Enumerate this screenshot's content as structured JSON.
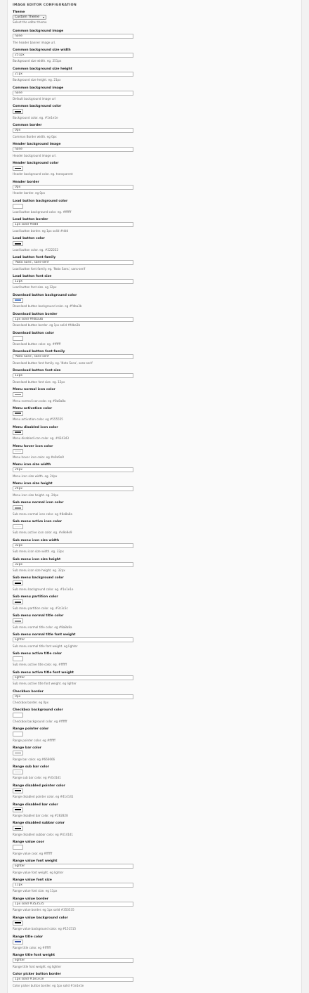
{
  "header": {
    "title": "IMAGE EDITOR CONFIGURATION"
  },
  "theme": {
    "label": "Theme",
    "selected": "Custom Theme",
    "arrow": "▾",
    "description": "Select the editor theme"
  },
  "fields": [
    {
      "label": "Common background image",
      "type": "text",
      "value": "none",
      "description": "The header banner image url."
    },
    {
      "label": "Common background size width",
      "type": "text",
      "value": "251px",
      "description": "Background size width. eg. 251px"
    },
    {
      "label": "Common background size height",
      "type": "text",
      "value": "21px",
      "description": "Background size height. eg. 21px"
    },
    {
      "label": "Common background image",
      "type": "text",
      "value": "none",
      "description": "Default background image url"
    },
    {
      "label": "Common background color",
      "type": "color",
      "value": "#1e1e1e",
      "description": "Background color. eg. #1e1e1e"
    },
    {
      "label": "Common border",
      "type": "text",
      "value": "0px",
      "description": "Common Border width. eg 0px"
    },
    {
      "label": "Header background image",
      "type": "text",
      "value": "none",
      "description": "Header background image url."
    },
    {
      "label": "Header background color",
      "type": "color",
      "value": "#000000",
      "description": "Header background color. eg. transparent"
    },
    {
      "label": "Header border",
      "type": "text",
      "value": "0px",
      "description": "Header border. eg 0px"
    },
    {
      "label": "Load button background color",
      "type": "color",
      "value": "#ffffff",
      "description": "Load button background color. eg. #ffffff"
    },
    {
      "label": "Load button border",
      "type": "text",
      "value": "1px solid #ddd",
      "description": "Load button border. eg 1px solid #ddd"
    },
    {
      "label": "Load button color",
      "type": "color",
      "value": "#222222",
      "description": "Load button color. eg. #222222"
    },
    {
      "label": "Load button font family",
      "type": "text",
      "value": "'Noto Sans', sans-serif",
      "description": "Load button font family. eg. 'Noto Sans', sans-serif"
    },
    {
      "label": "Load button font size",
      "type": "text",
      "value": "12px",
      "description": "Load button font size. eg 12px"
    },
    {
      "label": "Download button background color",
      "type": "color",
      "value": "#5684d1",
      "description": "Download button background color. eg #fdba3b"
    },
    {
      "label": "Download button border",
      "type": "text",
      "value": "1px solid #fdba3b",
      "description": "Download button border. eg 1px solid #fdba3b"
    },
    {
      "label": "Download button color",
      "type": "color",
      "value": "#ffffff",
      "description": "Download button color. eg. #ffffff"
    },
    {
      "label": "Download button font family",
      "type": "text",
      "value": "'Noto Sans', sans-serif",
      "description": "Download button font family. eg. 'Noto Sans', sans-serif"
    },
    {
      "label": "Download button font size",
      "type": "text",
      "value": "12px",
      "description": "Download button font size. eg. 12px"
    },
    {
      "label": "Menu normal icon color",
      "type": "color",
      "value": "#8a8a8a",
      "description": "Menu normal icon color. eg #8a8a8a"
    },
    {
      "label": "Menu activation color",
      "type": "color",
      "value": "#555555",
      "description": "Menu activation color. eg #555555"
    },
    {
      "label": "Menu disabled icon color",
      "type": "color",
      "value": "#434343",
      "description": "Menu disabled icon color. eg. #434343"
    },
    {
      "label": "Menu hover icon color",
      "type": "color",
      "value": "#e9e9e9",
      "description": "Menu hover icon color. eg #e9e9e9"
    },
    {
      "label": "Menu icon size width",
      "type": "text",
      "value": "24px",
      "description": "Menu icon size width. eg. 24px"
    },
    {
      "label": "Menu icon size height",
      "type": "text",
      "value": "24px",
      "description": "Menu icon size height. eg. 24px"
    },
    {
      "label": "Sub menu normal icon color",
      "type": "color",
      "value": "#8a8a8a",
      "description": "Sub menu normal icon color. eg #8a8a8a"
    },
    {
      "label": "Sub menu active icon color",
      "type": "color",
      "value": "#e9e9e9",
      "description": "Sub menu active icon color. eg. #e9e9e9"
    },
    {
      "label": "Sub menu icon size width",
      "type": "text",
      "value": "32px",
      "description": "Sub menu icon size width. eg. 32px"
    },
    {
      "label": "Sub menu icon size height",
      "type": "text",
      "value": "32px",
      "description": "Sub menu icon size height. eg. 32px"
    },
    {
      "label": "Sub menu background color",
      "type": "color",
      "value": "#000000",
      "description": "Sub menu background color. eg. #1e1e1e"
    },
    {
      "label": "Sub menu partition color",
      "type": "color",
      "value": "#3c3c3c",
      "description": "Sub menu partition color. eg. #3c3c3c"
    },
    {
      "label": "Sub menu normal title color",
      "type": "color",
      "value": "#8a8a8a",
      "description": "Sub menu normal title color. eg #8a8a8a"
    },
    {
      "label": "Sub menu normal title font weight",
      "type": "text",
      "value": "lighter",
      "description": "Sub menu normal title font weight. eg lighter"
    },
    {
      "label": "Sub menu active title color",
      "type": "color",
      "value": "#ffffff",
      "description": "Sub menu active title color. eg. #ffffff"
    },
    {
      "label": "Sub menu active title font weight",
      "type": "text",
      "value": "lighter",
      "description": "Sub menu active title font weight. eg lighter"
    },
    {
      "label": "Checkbox border",
      "type": "text",
      "value": "0px",
      "description": "Checkbox border. eg 0px"
    },
    {
      "label": "Checkbox background color",
      "type": "color",
      "value": "#ffffff",
      "description": "Checkbox background color. eg #ffffff"
    },
    {
      "label": "Range pointer color",
      "type": "color",
      "value": "#ffffff",
      "description": "Range pointer color. eg #ffffff"
    },
    {
      "label": "Range bar color",
      "type": "color",
      "value": "#666666",
      "description": "Range bar color. eg #666666"
    },
    {
      "label": "Range sub bar color",
      "type": "color",
      "value": "#d1d1d1",
      "description": "Range sub bar color. eg #d1d1d1"
    },
    {
      "label": "Range disabled pointer color",
      "type": "color",
      "value": "#141414",
      "description": "Range disabled pointer color. eg #414141"
    },
    {
      "label": "Range disabled bar color",
      "type": "color",
      "value": "#000000",
      "description": "Range disabled bar color. eg #282828"
    },
    {
      "label": "Range disabled subbar color",
      "type": "color",
      "value": "#141414",
      "description": "Range disabled subbar color. eg #414141"
    },
    {
      "label": "Range value coor",
      "type": "color",
      "value": "#ffffff",
      "description": "Range value coor. eg #ffffff"
    },
    {
      "label": "Range value font weight",
      "type": "text",
      "value": "lighter",
      "description": "Range value font weight. eg lighter"
    },
    {
      "label": "Range value font size",
      "type": "text",
      "value": "11px",
      "description": "Range value font size. eg 11px"
    },
    {
      "label": "Range value border",
      "type": "text",
      "value": "1px solid #353535",
      "description": "Range value border. eg 1px solid #353535"
    },
    {
      "label": "Range value background color",
      "type": "color",
      "value": "#000000",
      "description": "Range value background color. eg #151515"
    },
    {
      "label": "Range title color",
      "type": "color",
      "value": "#3b55a9",
      "description": "Range title color. eg #ffffff"
    },
    {
      "label": "Range title font weight",
      "type": "text",
      "value": "lighter",
      "description": "Range title font weight. eg lighter"
    },
    {
      "label": "Color picker button border",
      "type": "text",
      "value": "1px solid #1e1e1e",
      "description": "Color picker button border. eg 1px solid #1e1e1e"
    }
  ]
}
